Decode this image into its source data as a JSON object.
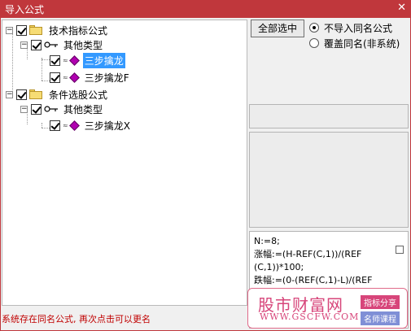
{
  "window": {
    "title": "导入公式",
    "close_glyph": "✕"
  },
  "tree": {
    "nodes": [
      {
        "label": "技术指标公式",
        "type": "folder",
        "expander": "−"
      },
      {
        "label": "其他类型",
        "type": "key",
        "expander": "−"
      },
      {
        "label": "三步擒龙",
        "type": "formula",
        "selected": true
      },
      {
        "label": "三步擒龙F",
        "type": "formula"
      },
      {
        "label": "条件选股公式",
        "type": "folder",
        "expander": "−"
      },
      {
        "label": "其他类型",
        "type": "key",
        "expander": "−"
      },
      {
        "label": "三步擒龙X",
        "type": "formula"
      }
    ]
  },
  "options": {
    "select_all_label": "全部选中",
    "radio_skip_label": "不导入同名公式",
    "radio_overwrite_label": "覆盖同名(非系统)",
    "radio_selected": "skip"
  },
  "formula_preview": {
    "lines": [
      "N:=8;",
      "涨幅:=(H-REF(C,1))/(REF",
      "(C,1))*100;",
      "跌幅:=(0-(REF(C,1)-L)/(REF"
    ]
  },
  "status_text": "系统存在同名公式, 再次点击可以更名",
  "watermark": {
    "brand": "股市财富网",
    "url": "WWW.GSCFW.COM",
    "tag1": "指标分享",
    "tag2": "名师课程"
  },
  "colors": {
    "titlebar": "#c0373c",
    "selection": "#3399ff",
    "status_text": "#c00000",
    "formula_icon": "#b000b0"
  }
}
